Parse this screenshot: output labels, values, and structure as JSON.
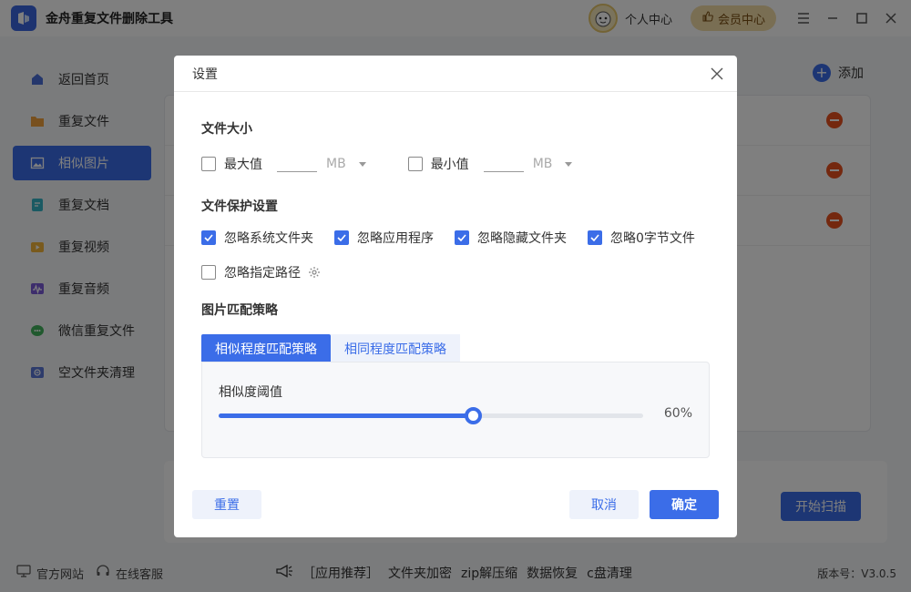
{
  "app": {
    "title": "金舟重复文件删除工具",
    "personal_center": "个人中心",
    "vip_center": "会员中心"
  },
  "sidebar": {
    "items": [
      {
        "label": "返回首页",
        "icon": "home-icon"
      },
      {
        "label": "重复文件",
        "icon": "folder-icon"
      },
      {
        "label": "相似图片",
        "icon": "image-icon",
        "active": true
      },
      {
        "label": "重复文档",
        "icon": "document-icon"
      },
      {
        "label": "重复视频",
        "icon": "video-icon"
      },
      {
        "label": "重复音频",
        "icon": "audio-icon"
      },
      {
        "label": "微信重复文件",
        "icon": "wechat-icon"
      },
      {
        "label": "空文件夹清理",
        "icon": "empty-folder-icon"
      }
    ]
  },
  "main": {
    "add_label": "添加",
    "start_scan": "开始扫描"
  },
  "footer": {
    "official_site": "官方网站",
    "online_service": "在线客服",
    "promo_prefix": "［应用推荐］",
    "promo_links": [
      "文件夹加密",
      "zip解压缩",
      "数据恢复",
      "c盘清理"
    ],
    "version": "版本号：V3.0.5"
  },
  "dialog": {
    "title": "设置",
    "file_size": {
      "title": "文件大小",
      "max_label": "最大值",
      "min_label": "最小值",
      "unit": "MB",
      "max_value": "",
      "min_value": ""
    },
    "protection": {
      "title": "文件保护设置",
      "options": [
        {
          "label": "忽略系统文件夹",
          "checked": true
        },
        {
          "label": "忽略应用程序",
          "checked": true
        },
        {
          "label": "忽略隐藏文件夹",
          "checked": true
        },
        {
          "label": "忽略0字节文件",
          "checked": true
        }
      ],
      "ignore_path": {
        "label": "忽略指定路径",
        "checked": false
      }
    },
    "match_strategy": {
      "title": "图片匹配策略",
      "tabs": [
        "相似程度匹配策略",
        "相同程度匹配策略"
      ],
      "threshold_label": "相似度阈值",
      "threshold_value": "60%",
      "threshold_fraction": 0.6
    },
    "buttons": {
      "reset": "重置",
      "cancel": "取消",
      "ok": "确定"
    }
  },
  "colors": {
    "primary": "#3b6de8",
    "danger": "#e8501e",
    "vip_bg": "#f3dca7"
  }
}
